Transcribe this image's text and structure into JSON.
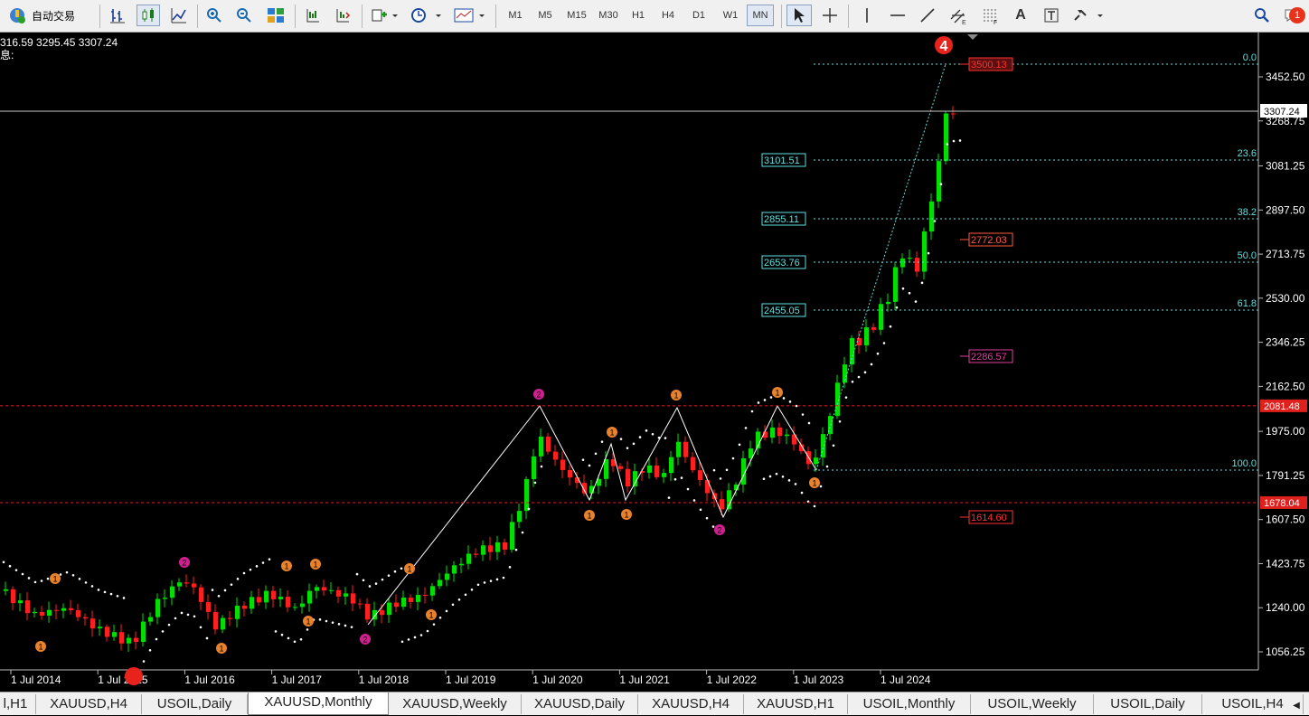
{
  "toolbar": {
    "auto_trade_label": "自动交易",
    "timeframes": [
      "M1",
      "M5",
      "M15",
      "M30",
      "H1",
      "H4",
      "D1",
      "W1",
      "MN"
    ],
    "active_timeframe": "MN",
    "notification_count": "1"
  },
  "chart": {
    "info_line1": "316.59 3295.45 3307.24",
    "info_line2": "息:",
    "price_ticks": [
      "3452.50",
      "3268.75",
      "3081.25",
      "2897.50",
      "2713.75",
      "2530.00",
      "2346.25",
      "2162.50",
      "1975.00",
      "1791.25",
      "1607.50",
      "1423.75",
      "1240.00",
      "1056.25"
    ],
    "time_ticks": [
      "1 Jul 2014",
      "1 Jul 2015",
      "1 Jul 2016",
      "1 Jul 2017",
      "1 Jul 2018",
      "1 Jul 2019",
      "1 Jul 2020",
      "1 Jul 2021",
      "1 Jul 2022",
      "1 Jul 2023",
      "1 Jul 2024"
    ],
    "current_price": "3307.24",
    "hline_labels": [
      "2081.48",
      "1678.04"
    ],
    "fib_levels": [
      "0.0",
      "23.6",
      "38.2",
      "50.0",
      "61.8",
      "100.0"
    ],
    "fib_prices": [
      "3101.51",
      "2855.11",
      "2653.76",
      "2455.05"
    ],
    "target_labels": [
      "3500.13",
      "2772.03",
      "2286.57",
      "1614.60"
    ],
    "wave_label": "4",
    "colors": {
      "bull": "#00e000",
      "bear": "#ff1f1f",
      "fib": "#5fe0e0",
      "hline": "#e02020",
      "pivot_orange": "#e8822c",
      "pivot_magenta": "#d02090"
    }
  },
  "tabs": [
    "l,H1",
    "XAUUSD,H4",
    "USOIL,Daily",
    "XAUUSD,Monthly",
    "XAUUSD,Weekly",
    "XAUUSD,Daily",
    "XAUUSD,H4",
    "XAUUSD,H1",
    "USOIL,Monthly",
    "USOIL,Weekly",
    "USOIL,Daily",
    "USOIL,H4"
  ],
  "active_tab": "XAUUSD,Monthly"
}
